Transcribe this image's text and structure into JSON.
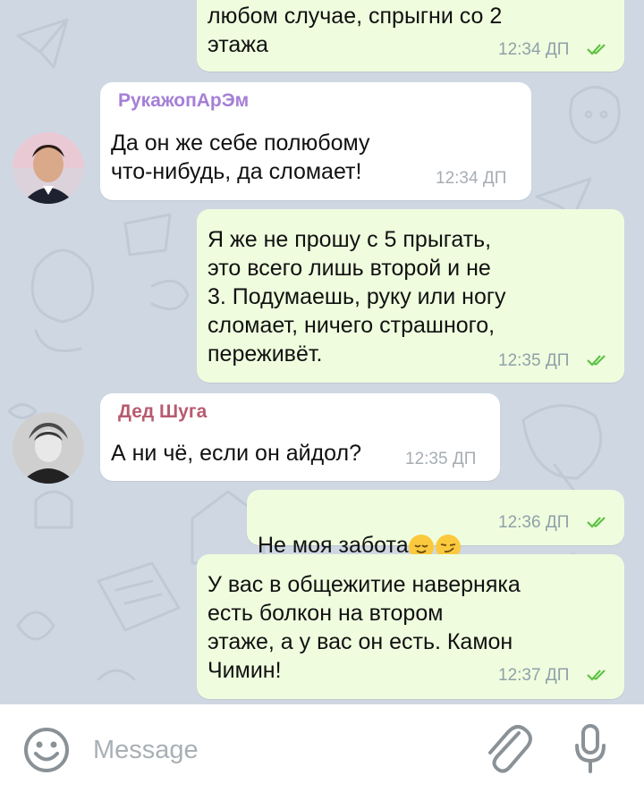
{
  "messages": [
    {
      "id": "m1",
      "dir": "out",
      "text": "любом случае, спрыгни со 2\nэтажа",
      "time": "12:34 ДП",
      "read": true
    },
    {
      "id": "m2",
      "dir": "in",
      "sender": "РукажопАрЭм",
      "text": "Да он же себе полюбому\nчто-нибудь, да сломает!",
      "time": "12:34 ДП"
    },
    {
      "id": "m3",
      "dir": "out",
      "text": "Я же не прошу с 5 прыгать,\nэто всего лишь второй и не\n3. Подумаешь, руку или ногу\nсломает, ничего страшного,\nпереживёт.",
      "time": "12:35 ДП",
      "read": true
    },
    {
      "id": "m4",
      "dir": "in",
      "sender": "Дед Шуга",
      "text": "А ни чё, если он айдол?",
      "time": "12:35 ДП"
    },
    {
      "id": "m5",
      "dir": "out",
      "text": "Не моя забота",
      "emojis": [
        "relieved-face-emoji",
        "smirking-face-emoji"
      ],
      "time": "12:36 ДП",
      "read": true
    },
    {
      "id": "m6",
      "dir": "out",
      "text": "У вас в общежитие наверняка\nесть болкон на втором\nэтаже, а у вас он есть. Камон\nЧимин!",
      "time": "12:37 ДП",
      "read": true
    }
  ],
  "colors": {
    "outgoing_bubble": "#effdde",
    "incoming_bubble": "#ffffff",
    "read_check": "#5ec245",
    "sender_1": "#a57fd6",
    "sender_2": "#b75b6f",
    "background": "#cfd8e2"
  },
  "input": {
    "placeholder": "Message"
  },
  "icons": {
    "emoji": "smile-icon",
    "attach": "paperclip-icon",
    "mic": "microphone-icon"
  }
}
